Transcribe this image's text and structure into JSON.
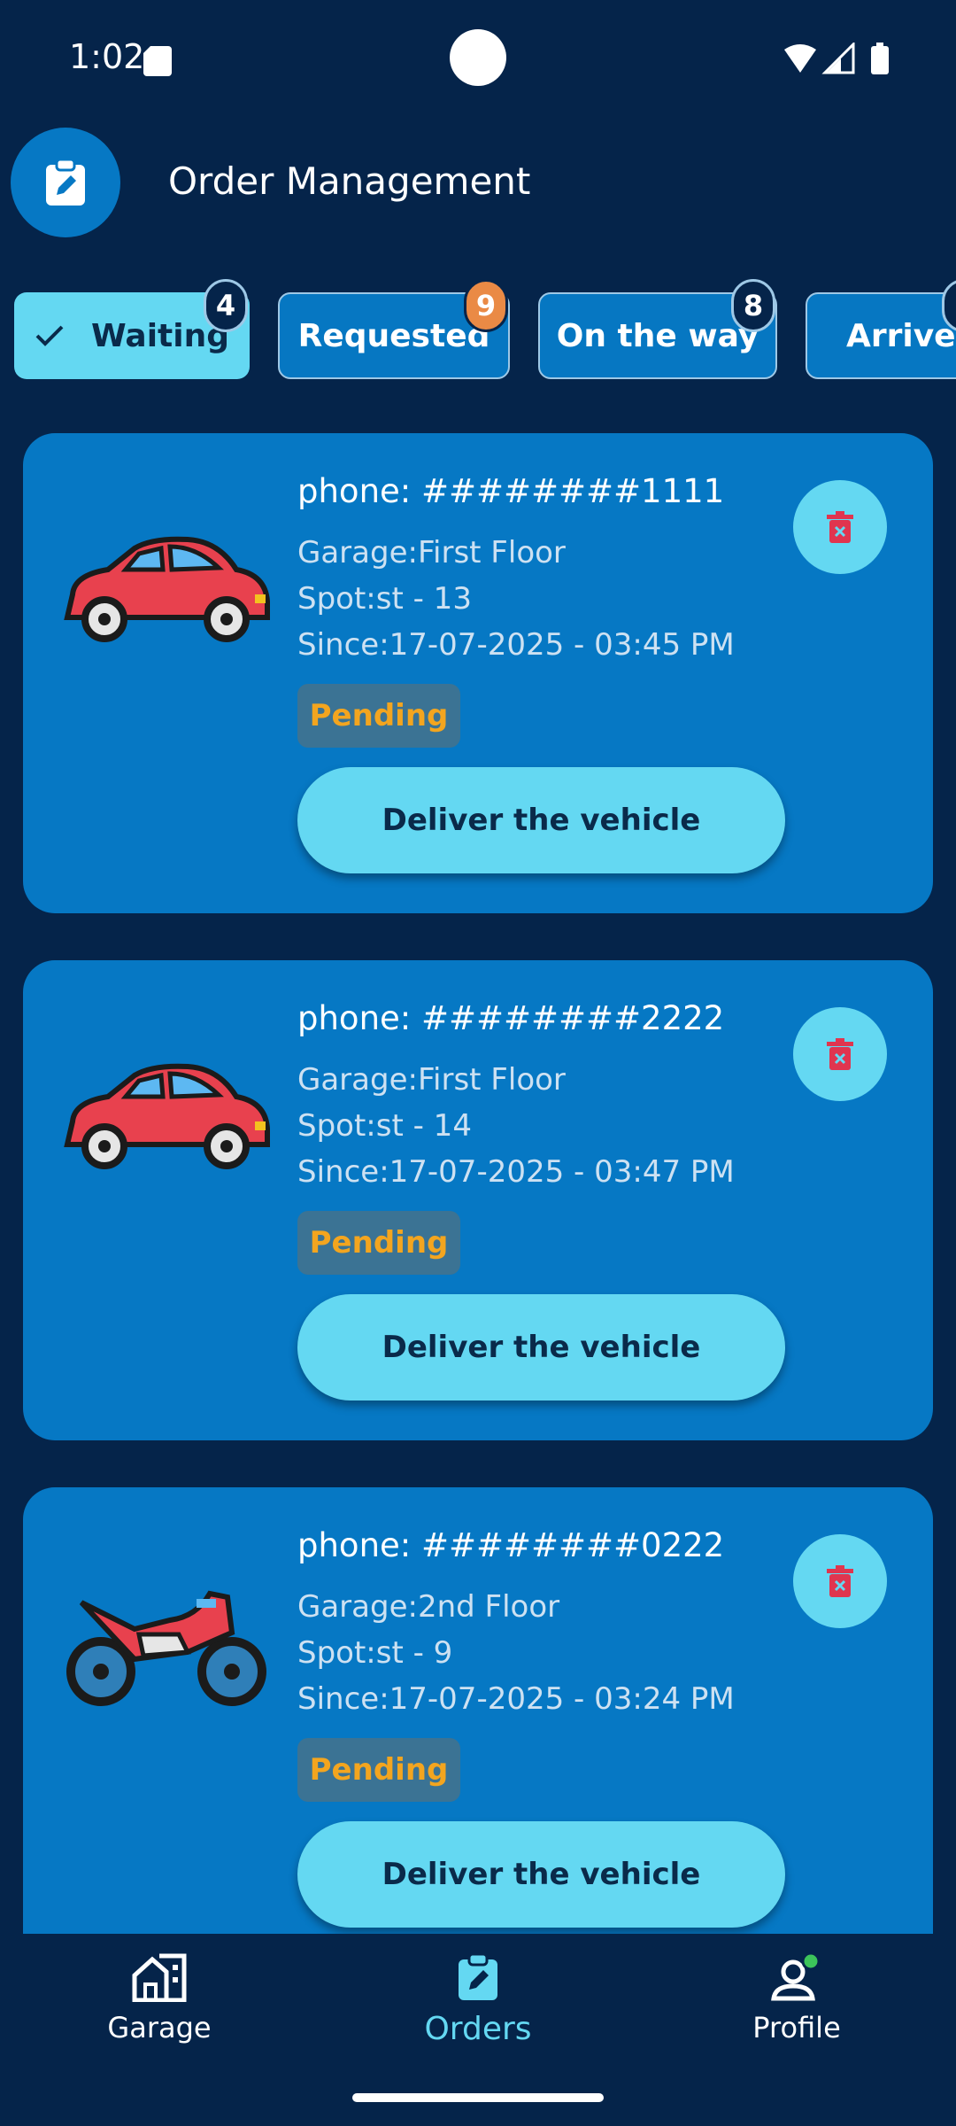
{
  "status_bar": {
    "time": "1:02"
  },
  "header": {
    "title": "Order Management",
    "icon": "clipboard-edit-icon"
  },
  "tabs": [
    {
      "label": "Waiting",
      "count": "4",
      "active": true
    },
    {
      "label": "Requested",
      "count": "9",
      "active": false
    },
    {
      "label": "On the way",
      "count": "8",
      "active": false
    },
    {
      "label": "Arrived",
      "count": "",
      "active": false
    }
  ],
  "orders": [
    {
      "vehicle": "car-icon",
      "phone": "phone: ########1111",
      "garage": "Garage:First Floor",
      "spot": "Spot:st - 13",
      "since": "Since:17-07-2025 - 03:45 PM",
      "status": "Pending",
      "action": "Deliver the vehicle"
    },
    {
      "vehicle": "car-icon",
      "phone": "phone: ########2222",
      "garage": "Garage:First Floor",
      "spot": "Spot:st - 14",
      "since": "Since:17-07-2025 - 03:47 PM",
      "status": "Pending",
      "action": "Deliver the vehicle"
    },
    {
      "vehicle": "motorcycle-icon",
      "phone": "phone: ########0222",
      "garage": "Garage:2nd Floor",
      "spot": "Spot:st - 9",
      "since": "Since:17-07-2025 - 03:24 PM",
      "status": "Pending",
      "action": "Deliver the vehicle"
    }
  ],
  "bottom_nav": [
    {
      "label": "Garage",
      "icon": "garage-icon",
      "active": false
    },
    {
      "label": "Orders",
      "icon": "clipboard-edit-icon",
      "active": true
    },
    {
      "label": "Profile",
      "icon": "profile-icon",
      "active": false
    }
  ],
  "colors": {
    "background": "#05244a",
    "card": "#0678c4",
    "accent": "#64d8f2",
    "pending": "#f3a51f",
    "badge_orange": "#ea8a45",
    "delete": "#e0354f"
  }
}
